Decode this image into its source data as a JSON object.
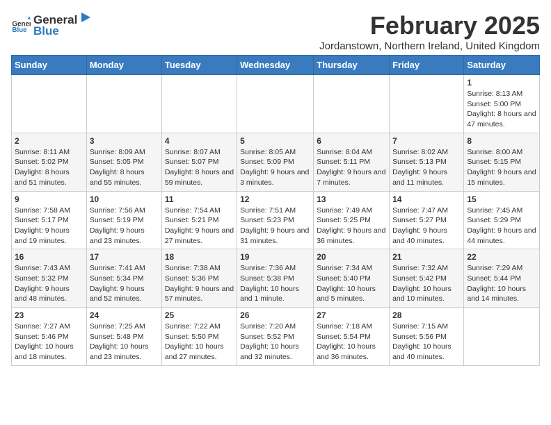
{
  "logo": {
    "general": "General",
    "blue": "Blue"
  },
  "title": "February 2025",
  "location": "Jordanstown, Northern Ireland, United Kingdom",
  "weekdays": [
    "Sunday",
    "Monday",
    "Tuesday",
    "Wednesday",
    "Thursday",
    "Friday",
    "Saturday"
  ],
  "weeks": [
    [
      {
        "day": "",
        "info": ""
      },
      {
        "day": "",
        "info": ""
      },
      {
        "day": "",
        "info": ""
      },
      {
        "day": "",
        "info": ""
      },
      {
        "day": "",
        "info": ""
      },
      {
        "day": "",
        "info": ""
      },
      {
        "day": "1",
        "info": "Sunrise: 8:13 AM\nSunset: 5:00 PM\nDaylight: 8 hours and 47 minutes."
      }
    ],
    [
      {
        "day": "2",
        "info": "Sunrise: 8:11 AM\nSunset: 5:02 PM\nDaylight: 8 hours and 51 minutes."
      },
      {
        "day": "3",
        "info": "Sunrise: 8:09 AM\nSunset: 5:05 PM\nDaylight: 8 hours and 55 minutes."
      },
      {
        "day": "4",
        "info": "Sunrise: 8:07 AM\nSunset: 5:07 PM\nDaylight: 8 hours and 59 minutes."
      },
      {
        "day": "5",
        "info": "Sunrise: 8:05 AM\nSunset: 5:09 PM\nDaylight: 9 hours and 3 minutes."
      },
      {
        "day": "6",
        "info": "Sunrise: 8:04 AM\nSunset: 5:11 PM\nDaylight: 9 hours and 7 minutes."
      },
      {
        "day": "7",
        "info": "Sunrise: 8:02 AM\nSunset: 5:13 PM\nDaylight: 9 hours and 11 minutes."
      },
      {
        "day": "8",
        "info": "Sunrise: 8:00 AM\nSunset: 5:15 PM\nDaylight: 9 hours and 15 minutes."
      }
    ],
    [
      {
        "day": "9",
        "info": "Sunrise: 7:58 AM\nSunset: 5:17 PM\nDaylight: 9 hours and 19 minutes."
      },
      {
        "day": "10",
        "info": "Sunrise: 7:56 AM\nSunset: 5:19 PM\nDaylight: 9 hours and 23 minutes."
      },
      {
        "day": "11",
        "info": "Sunrise: 7:54 AM\nSunset: 5:21 PM\nDaylight: 9 hours and 27 minutes."
      },
      {
        "day": "12",
        "info": "Sunrise: 7:51 AM\nSunset: 5:23 PM\nDaylight: 9 hours and 31 minutes."
      },
      {
        "day": "13",
        "info": "Sunrise: 7:49 AM\nSunset: 5:25 PM\nDaylight: 9 hours and 36 minutes."
      },
      {
        "day": "14",
        "info": "Sunrise: 7:47 AM\nSunset: 5:27 PM\nDaylight: 9 hours and 40 minutes."
      },
      {
        "day": "15",
        "info": "Sunrise: 7:45 AM\nSunset: 5:29 PM\nDaylight: 9 hours and 44 minutes."
      }
    ],
    [
      {
        "day": "16",
        "info": "Sunrise: 7:43 AM\nSunset: 5:32 PM\nDaylight: 9 hours and 48 minutes."
      },
      {
        "day": "17",
        "info": "Sunrise: 7:41 AM\nSunset: 5:34 PM\nDaylight: 9 hours and 52 minutes."
      },
      {
        "day": "18",
        "info": "Sunrise: 7:38 AM\nSunset: 5:36 PM\nDaylight: 9 hours and 57 minutes."
      },
      {
        "day": "19",
        "info": "Sunrise: 7:36 AM\nSunset: 5:38 PM\nDaylight: 10 hours and 1 minute."
      },
      {
        "day": "20",
        "info": "Sunrise: 7:34 AM\nSunset: 5:40 PM\nDaylight: 10 hours and 5 minutes."
      },
      {
        "day": "21",
        "info": "Sunrise: 7:32 AM\nSunset: 5:42 PM\nDaylight: 10 hours and 10 minutes."
      },
      {
        "day": "22",
        "info": "Sunrise: 7:29 AM\nSunset: 5:44 PM\nDaylight: 10 hours and 14 minutes."
      }
    ],
    [
      {
        "day": "23",
        "info": "Sunrise: 7:27 AM\nSunset: 5:46 PM\nDaylight: 10 hours and 18 minutes."
      },
      {
        "day": "24",
        "info": "Sunrise: 7:25 AM\nSunset: 5:48 PM\nDaylight: 10 hours and 23 minutes."
      },
      {
        "day": "25",
        "info": "Sunrise: 7:22 AM\nSunset: 5:50 PM\nDaylight: 10 hours and 27 minutes."
      },
      {
        "day": "26",
        "info": "Sunrise: 7:20 AM\nSunset: 5:52 PM\nDaylight: 10 hours and 32 minutes."
      },
      {
        "day": "27",
        "info": "Sunrise: 7:18 AM\nSunset: 5:54 PM\nDaylight: 10 hours and 36 minutes."
      },
      {
        "day": "28",
        "info": "Sunrise: 7:15 AM\nSunset: 5:56 PM\nDaylight: 10 hours and 40 minutes."
      },
      {
        "day": "",
        "info": ""
      }
    ]
  ]
}
